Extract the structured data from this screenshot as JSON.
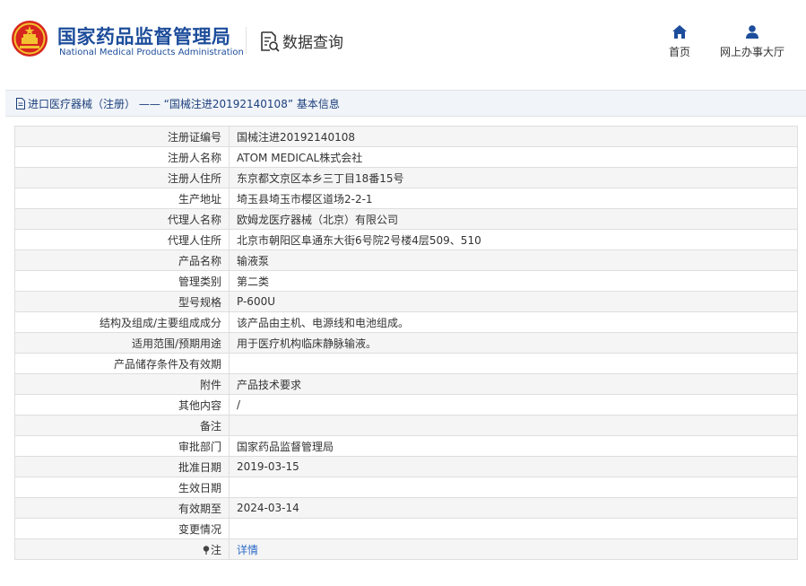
{
  "header": {
    "brand_cn": "国家药品监督管理局",
    "brand_en": "National Medical Products Administration",
    "data_query": "数据查询",
    "nav_home": "首页",
    "nav_office": "网上办事大厅",
    "colors": {
      "brand": "#1d4d9b",
      "accent": "#2d6bc7"
    }
  },
  "title": "进口医疗器械（注册） —— “国械注进20192140108” 基本信息",
  "rows": [
    {
      "label": "注册证编号",
      "value": "国械注进20192140108"
    },
    {
      "label": "注册人名称",
      "value": "ATOM MEDICAL株式会社"
    },
    {
      "label": "注册人住所",
      "value": "东京都文京区本乡三丁目18番15号"
    },
    {
      "label": "生产地址",
      "value": "埼玉县埼玉市樱区道场2-2-1"
    },
    {
      "label": "代理人名称",
      "value": "欧姆龙医疗器械（北京）有限公司"
    },
    {
      "label": "代理人住所",
      "value": "北京市朝阳区阜通东大街6号院2号楼4层509、510"
    },
    {
      "label": "产品名称",
      "value": "输液泵"
    },
    {
      "label": "管理类别",
      "value": "第二类"
    },
    {
      "label": "型号规格",
      "value": "P-600U"
    },
    {
      "label": "结构及组成/主要组成成分",
      "value": "该产品由主机、电源线和电池组成。"
    },
    {
      "label": "适用范围/预期用途",
      "value": "用于医疗机构临床静脉输液。"
    },
    {
      "label": "产品储存条件及有效期",
      "value": ""
    },
    {
      "label": "附件",
      "value": "产品技术要求"
    },
    {
      "label": "其他内容",
      "value": "/"
    },
    {
      "label": "备注",
      "value": ""
    },
    {
      "label": "审批部门",
      "value": "国家药品监督管理局"
    },
    {
      "label": "批准日期",
      "value": "2019-03-15"
    },
    {
      "label": "生效日期",
      "value": ""
    },
    {
      "label": "有效期至",
      "value": "2024-03-14"
    },
    {
      "label": "变更情况",
      "value": ""
    },
    {
      "label": "注",
      "value": "详情"
    }
  ]
}
